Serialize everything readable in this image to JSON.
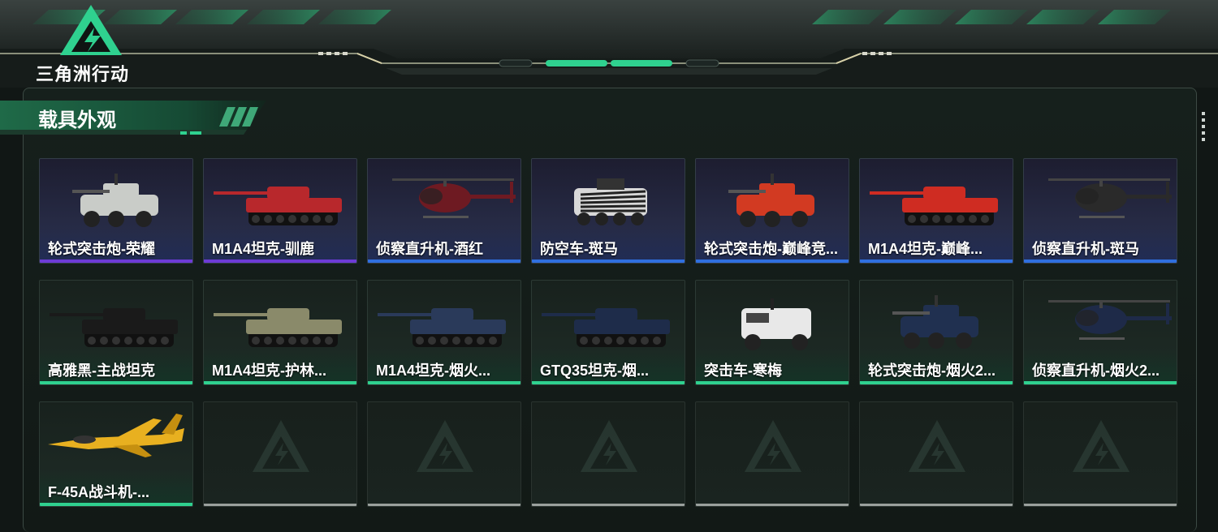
{
  "header": {
    "logo_text": "三角洲行动",
    "logo_icon": "triangle-bolt-logo"
  },
  "section": {
    "title": "载具外观"
  },
  "colors": {
    "accent": "#2fd18f",
    "purple": "#6d3bd6",
    "blue": "#2f6fe0",
    "grey": "#9aa09d"
  },
  "cards": [
    {
      "label": "轮式突击炮-荣耀",
      "rarity": "purple",
      "icon": "wheeled-assault-gun-icon"
    },
    {
      "label": "M1A4坦克-驯鹿",
      "rarity": "purple",
      "icon": "tank-icon"
    },
    {
      "label": "侦察直升机-酒红",
      "rarity": "blue",
      "icon": "helicopter-icon"
    },
    {
      "label": "防空车-斑马",
      "rarity": "blue",
      "icon": "aa-vehicle-icon"
    },
    {
      "label": "轮式突击炮-巅峰竞...",
      "rarity": "blue",
      "icon": "wheeled-assault-gun-icon"
    },
    {
      "label": "M1A4坦克-巅峰...",
      "rarity": "blue",
      "icon": "tank-icon"
    },
    {
      "label": "侦察直升机-斑马",
      "rarity": "blue",
      "icon": "helicopter-icon"
    },
    {
      "label": "高雅黑-主战坦克",
      "rarity": "green",
      "icon": "tank-icon"
    },
    {
      "label": "M1A4坦克-护林...",
      "rarity": "green",
      "icon": "tank-icon"
    },
    {
      "label": "M1A4坦克-烟火...",
      "rarity": "green",
      "icon": "tank-icon"
    },
    {
      "label": "GTQ35坦克-烟...",
      "rarity": "green",
      "icon": "tank-icon"
    },
    {
      "label": "突击车-寒梅",
      "rarity": "green",
      "icon": "assault-vehicle-icon"
    },
    {
      "label": "轮式突击炮-烟火2...",
      "rarity": "green",
      "icon": "wheeled-assault-gun-icon"
    },
    {
      "label": "侦察直升机-烟火2...",
      "rarity": "green",
      "icon": "helicopter-icon"
    },
    {
      "label": "F-45A战斗机-...",
      "rarity": "green",
      "icon": "fighter-jet-icon"
    },
    {
      "label": "",
      "rarity": "empty",
      "icon": "empty-slot-logo-icon"
    },
    {
      "label": "",
      "rarity": "empty",
      "icon": "empty-slot-logo-icon"
    },
    {
      "label": "",
      "rarity": "empty",
      "icon": "empty-slot-logo-icon"
    },
    {
      "label": "",
      "rarity": "empty",
      "icon": "empty-slot-logo-icon"
    },
    {
      "label": "",
      "rarity": "empty",
      "icon": "empty-slot-logo-icon"
    },
    {
      "label": "",
      "rarity": "empty",
      "icon": "empty-slot-logo-icon"
    }
  ]
}
